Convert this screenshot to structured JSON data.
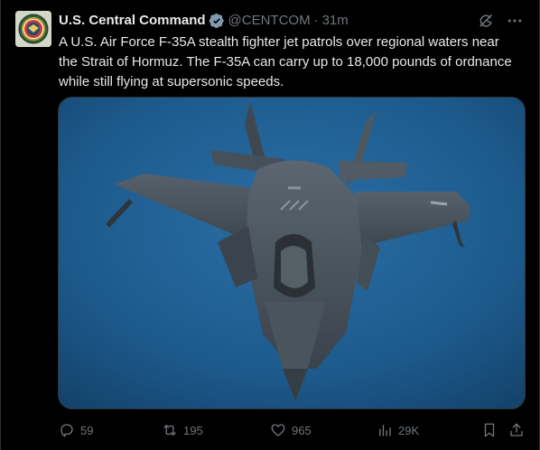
{
  "post": {
    "author_name": "U.S. Central Command",
    "verified_icon": "verified-badge-icon",
    "handle": "@CENTCOM",
    "separator": "·",
    "time": "31m",
    "text": "A U.S. Air Force F-35A stealth fighter jet patrols over regional waters near the Strait of Hormuz. The F-35A can carry up to 18,000 pounds of ordnance while still flying at supersonic speeds.",
    "media": {
      "alt": "F-35A stealth fighter jet in flight over water"
    }
  },
  "actions": {
    "replies": "59",
    "reposts": "195",
    "likes": "965",
    "views": "29K"
  },
  "icons": {
    "grok": "grok-icon",
    "more": "more-icon",
    "reply": "reply-icon",
    "repost": "repost-icon",
    "like": "like-icon",
    "views": "views-icon",
    "bookmark": "bookmark-icon",
    "share": "share-icon"
  },
  "colors": {
    "background": "#000000",
    "text_primary": "#e7e9ea",
    "text_secondary": "#71767b",
    "verified_badge": "#829aab",
    "border": "#2f3336"
  }
}
